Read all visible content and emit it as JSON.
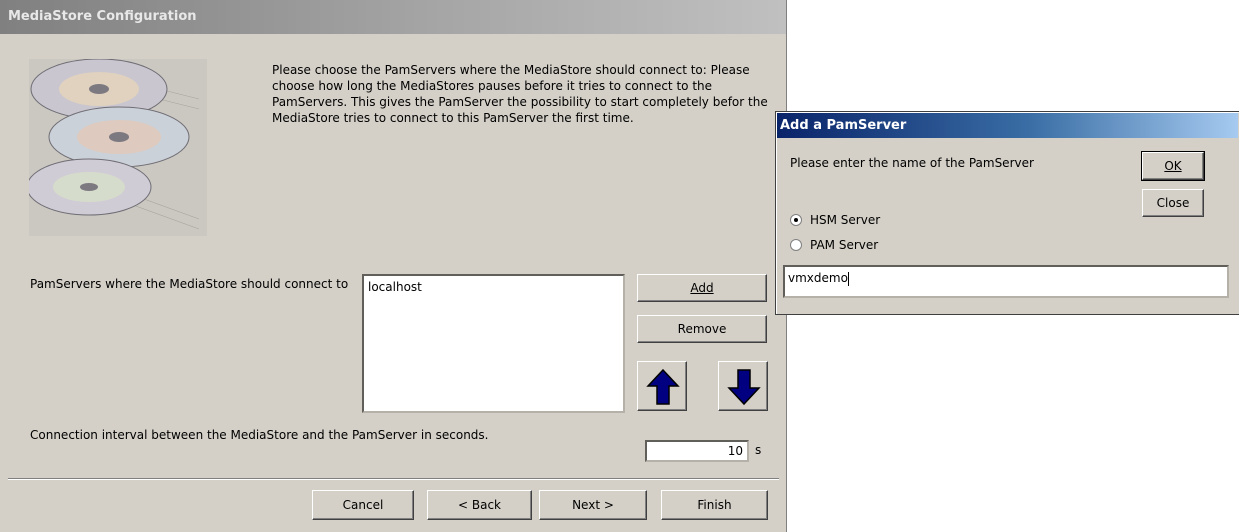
{
  "wizard": {
    "title": "MediaStore Configuration",
    "intro": "Please choose the PamServers where the MediaStore should connect to: Please choose how long the MediaStores pauses before it tries to connect to the PamServers. This gives the PamServer the possibility to start completely befor the MediaStore tries to connect to this PamServer the first time.",
    "servers_label": "PamServers where the MediaStore should connect to",
    "servers": [
      "localhost"
    ],
    "add_label": "Add",
    "remove_label": "Remove",
    "interval_label": "Connection interval between the MediaStore and the PamServer in seconds.",
    "interval_value": "10",
    "interval_unit": "s",
    "nav": {
      "cancel": "Cancel",
      "back": "< Back",
      "next": "Next >",
      "finish": "Finish"
    },
    "icons": {
      "up": "arrow-up-icon",
      "down": "arrow-down-icon",
      "image": "cd-discs-image"
    },
    "colors": {
      "arrow": "#000080",
      "face": "#d4d0c8"
    }
  },
  "dialog": {
    "title": "Add a PamServer",
    "prompt": "Please enter the name of the PamServer",
    "ok_label": "OK",
    "close_label": "Close",
    "radio_hsm": "HSM Server",
    "radio_pam": "PAM Server",
    "selected_radio": "HSM Server",
    "name_value": "vmxdemo",
    "colors": {
      "title_start": "#0a246a",
      "title_end": "#a6caf0"
    }
  }
}
